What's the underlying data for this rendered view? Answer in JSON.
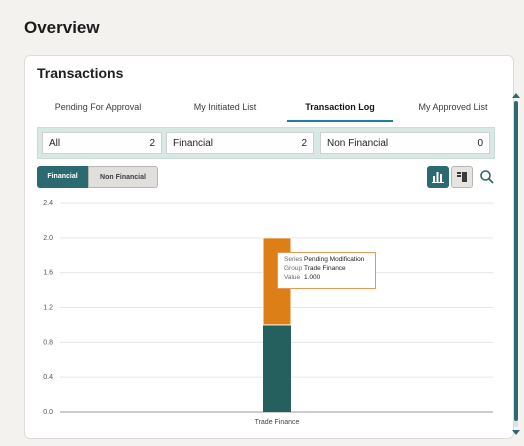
{
  "page": {
    "title": "Overview"
  },
  "card": {
    "title": "Transactions"
  },
  "tabs": [
    {
      "label": "Pending For Approval",
      "active": false
    },
    {
      "label": "My Initiated List",
      "active": false
    },
    {
      "label": "Transaction Log",
      "active": true
    },
    {
      "label": "My Approved List",
      "active": false
    }
  ],
  "filters": [
    {
      "label": "All",
      "count": "2"
    },
    {
      "label": "Financial",
      "count": "2"
    },
    {
      "label": "Non Financial",
      "count": "0"
    }
  ],
  "segment": {
    "financial": "Financial",
    "non_financial": "Non Financial",
    "selected": "Financial"
  },
  "icons": {
    "chart_view": "bar-chart-icon",
    "table_view": "table-icon",
    "search": "search-icon"
  },
  "colors": {
    "accent": "#2a6a70",
    "tab_underline": "#227e9e",
    "series_pending": "#dc7f17",
    "series_other": "#25605f"
  },
  "tooltip": {
    "series_key": "Series",
    "series_value": "Pending Modification",
    "group_key": "Group",
    "group_value": "Trade Finance",
    "value_key": "Value",
    "value_value": "1.000"
  },
  "chart_data": {
    "type": "bar",
    "stacked": true,
    "categories": [
      "Trade Finance"
    ],
    "series": [
      {
        "values": [
          1.0
        ],
        "color": "#25605f"
      },
      {
        "name": "Pending Modification",
        "values": [
          1.0
        ],
        "color": "#dc7f17"
      }
    ],
    "yticks": [
      "0.0",
      "0.4",
      "0.8",
      "1.2",
      "1.6",
      "2.0",
      "2.4"
    ],
    "ylim": [
      0,
      2.4
    ],
    "grid": true,
    "title": "",
    "xlabel": "",
    "ylabel": ""
  }
}
